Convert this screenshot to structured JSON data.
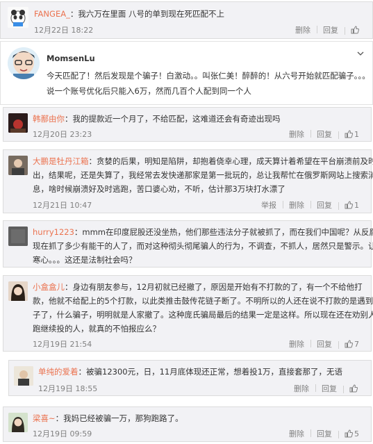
{
  "colors": {
    "accent_username": "#eb7350",
    "meta_gray": "#808080",
    "card_bg": "#f2f2f5"
  },
  "comments": [
    {
      "user": "FANGEA_",
      "lines": [
        "：我六万在里面 八号的单到现在死匹配不上"
      ],
      "time": "12月22日 18:22",
      "actions": {
        "delete": "删除",
        "reply": "回复",
        "like_icon": "thumb-up-icon"
      }
    },
    {
      "user": "MomsenLu",
      "lines": [
        "今天匹配了！然后发现是个骗子！白激动。。叫张仁美！醉醉的！从六号开始就匹配骗子。。。",
        "说一个账号优化后只能入6万，然而几百个人配到同一个人"
      ]
    },
    {
      "user": "韩鄯由你",
      "lines": [
        "：我的提款近一个月了，不给匹配，这难道还会有奇迹出现吗"
      ],
      "time": "12月20日 23:23",
      "actions": {
        "delete": "删除",
        "reply": "回复",
        "likes": "1"
      }
    },
    {
      "user": "大鹏是牡丹江箱",
      "lines": [
        "：贪婪的后果，明知是陷阱，却抱着侥幸心理，成天算计着希望在平台崩溃前及时跳",
        "出，结果呢，还是失算了，我经常去发快递那家是第一批玩的，总让我帮忙在俄罗斯网站上搜索消",
        "息，啥时候崩溃好及时逃跑，苦口婆心劝，不听，估计那3万块打水漂了"
      ],
      "time": "12月21日 10:47",
      "actions": {
        "report": "举报",
        "delete": "删除",
        "reply": "回复",
        "likes": "1"
      }
    },
    {
      "user": "hurry1223",
      "lines": [
        "：mmm在印度屁股还没坐热，他们那些违法分子就被抓了，而在我们中国呢？从反腐到",
        "现在抓了多少有能干的人了，而对这种彻头彻尾骗人的行为，不调查，不抓人，居然只是警示。让人",
        "寒心。。。这还是法制社会吗？"
      ]
    },
    {
      "user": "小盒盒儿",
      "lines": [
        "：身边有朋友参与，12月初就已经撤了，原因是开始有不打款的了，有一个不给他打",
        "款，他就不给配上的5个打款，以此类推击鼓传花链子断了。不明所以的人还在说不打款的是遇到骗",
        "子了，什么骗子，明明就是人家撤了。这种庞氏骗局最后的结果一定是这样。所以现在还在劝别人别",
        "跑继续投的人，就真的不怕报应么？"
      ],
      "time": "12月19日 21:54",
      "actions": {
        "delete": "删除",
        "reply": "回复",
        "likes": "7"
      }
    },
    {
      "user": "单纯的爱着",
      "lines": [
        "：被骗12300元，日，11月底体现还正常，想着投1万，直接套那了，无语"
      ],
      "time": "12月19日 18:55",
      "actions": {
        "delete": "删除",
        "reply": "回复",
        "like_icon": "thumb-up-icon"
      }
    },
    {
      "user": "梁喜~",
      "lines": [
        "：我妈已经被骗一万，那狗跑路了。"
      ],
      "time": "12月19日 09:59",
      "actions": {
        "delete": "删除",
        "reply": "回复",
        "likes": "5"
      }
    }
  ]
}
